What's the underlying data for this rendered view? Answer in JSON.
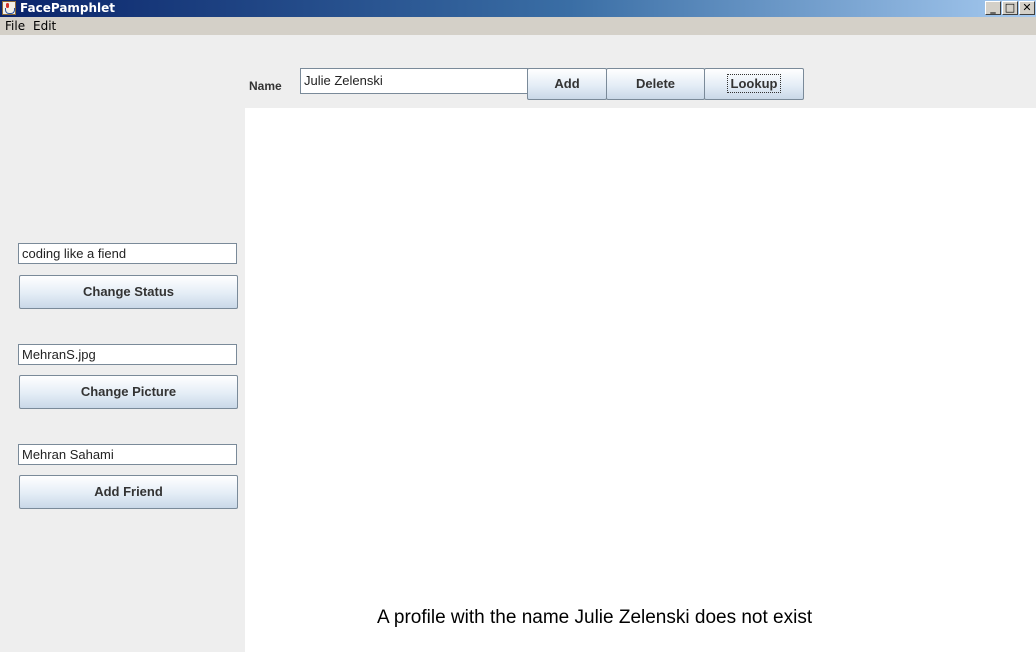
{
  "window": {
    "title": "FacePamphlet",
    "controls": {
      "minimize_icon": "minimize-icon",
      "maximize_icon": "maximize-icon",
      "close_icon": "close-icon"
    }
  },
  "menu": {
    "items": [
      {
        "label": "File"
      },
      {
        "label": "Edit"
      }
    ]
  },
  "toolbar": {
    "name_label": "Name",
    "name_value": "Julie Zelenski",
    "add_label": "Add",
    "delete_label": "Delete",
    "lookup_label": "Lookup"
  },
  "sidebar": {
    "status_value": "coding like a fiend",
    "change_status_label": "Change Status",
    "picture_value": "MehranS.jpg",
    "change_picture_label": "Change Picture",
    "friend_value": "Mehran Sahami",
    "add_friend_label": "Add Friend"
  },
  "canvas": {
    "message": "A profile with the name Julie Zelenski does not exist"
  },
  "colors": {
    "titlebar_start": "#0a246a",
    "titlebar_end": "#a6caf0",
    "panel_background": "#eeeeee",
    "canvas_background": "#ffffff"
  }
}
